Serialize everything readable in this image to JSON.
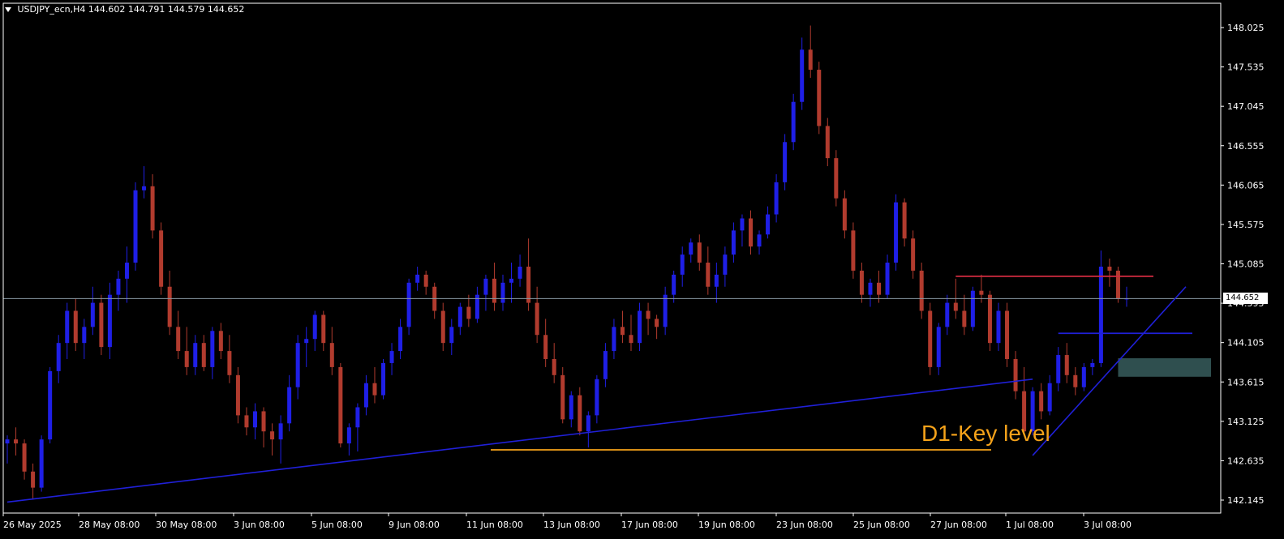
{
  "header": {
    "symbol": "USDJPY_ecn,H4",
    "ohlc": "144.602 144.791 144.579 144.652"
  },
  "annotation": {
    "key_level_label": "D1-Key level"
  },
  "current_price_label": "144.652",
  "colors": {
    "background": "#000000",
    "bull": "#1f1fe6",
    "bear": "#b13b2e",
    "axis": "#ffffff",
    "trendline": "#2020d8",
    "resistance": "#d22b40",
    "key_level": "#f5a21a",
    "support_zone": "#2f4f4f",
    "current_price_line": "#8a9aa4"
  },
  "chart_data": {
    "type": "candlestick",
    "title": "",
    "xlabel": "",
    "ylabel": "",
    "ylim": [
      142.0,
      148.3
    ],
    "y_ticks": [
      "148.025",
      "147.535",
      "147.045",
      "146.555",
      "146.065",
      "145.575",
      "145.085",
      "144.595",
      "144.105",
      "143.615",
      "143.125",
      "142.635",
      "142.145"
    ],
    "x_ticks": [
      "26 May 2025",
      "28 May 08:00",
      "30 May 08:00",
      "3 Jun 08:00",
      "5 Jun 08:00",
      "9 Jun 08:00",
      "11 Jun 08:00",
      "13 Jun 08:00",
      "17 Jun 08:00",
      "19 Jun 08:00",
      "23 Jun 08:00",
      "25 Jun 08:00",
      "27 Jun 08:00",
      "1 Jul 08:00",
      "3 Jul 08:00"
    ],
    "current_price": 144.652,
    "candles": [
      [
        142.85,
        142.95,
        142.6,
        142.9
      ],
      [
        142.9,
        143.05,
        142.7,
        142.85
      ],
      [
        142.85,
        142.9,
        142.4,
        142.5
      ],
      [
        142.5,
        142.6,
        142.15,
        142.3
      ],
      [
        142.3,
        142.95,
        142.25,
        142.9
      ],
      [
        142.9,
        143.8,
        142.85,
        143.75
      ],
      [
        143.75,
        144.2,
        143.6,
        144.1
      ],
      [
        144.1,
        144.6,
        143.9,
        144.5
      ],
      [
        144.5,
        144.65,
        144.0,
        144.1
      ],
      [
        144.1,
        144.4,
        143.9,
        144.3
      ],
      [
        144.3,
        144.8,
        144.2,
        144.6
      ],
      [
        144.6,
        144.7,
        143.95,
        144.05
      ],
      [
        144.05,
        144.85,
        143.9,
        144.7
      ],
      [
        144.7,
        145.0,
        144.5,
        144.9
      ],
      [
        144.9,
        145.3,
        144.6,
        145.1
      ],
      [
        145.1,
        146.1,
        145.0,
        146.0
      ],
      [
        146.0,
        146.3,
        145.9,
        146.05
      ],
      [
        146.05,
        146.2,
        145.4,
        145.5
      ],
      [
        145.5,
        145.6,
        144.7,
        144.8
      ],
      [
        144.8,
        145.0,
        144.2,
        144.3
      ],
      [
        144.3,
        144.5,
        143.9,
        144.0
      ],
      [
        144.0,
        144.3,
        143.7,
        143.8
      ],
      [
        143.8,
        144.2,
        143.7,
        144.1
      ],
      [
        144.1,
        144.2,
        143.75,
        143.8
      ],
      [
        143.8,
        144.3,
        143.65,
        144.25
      ],
      [
        144.25,
        144.35,
        143.9,
        144.0
      ],
      [
        144.0,
        144.2,
        143.6,
        143.7
      ],
      [
        143.7,
        143.8,
        143.1,
        143.2
      ],
      [
        143.2,
        143.3,
        142.95,
        143.05
      ],
      [
        143.05,
        143.35,
        142.9,
        143.25
      ],
      [
        143.25,
        143.3,
        142.8,
        143.0
      ],
      [
        143.0,
        143.1,
        142.7,
        142.9
      ],
      [
        142.9,
        143.2,
        142.6,
        143.1
      ],
      [
        143.1,
        143.7,
        143.0,
        143.55
      ],
      [
        143.55,
        144.2,
        143.4,
        144.1
      ],
      [
        144.1,
        144.3,
        143.8,
        144.15
      ],
      [
        144.15,
        144.5,
        144.0,
        144.45
      ],
      [
        144.45,
        144.5,
        144.0,
        144.1
      ],
      [
        144.1,
        144.3,
        143.7,
        143.8
      ],
      [
        143.8,
        143.85,
        142.8,
        142.85
      ],
      [
        142.85,
        143.1,
        142.7,
        143.05
      ],
      [
        143.05,
        143.35,
        142.75,
        143.3
      ],
      [
        143.3,
        143.7,
        143.2,
        143.6
      ],
      [
        143.6,
        143.8,
        143.35,
        143.45
      ],
      [
        143.45,
        143.9,
        143.4,
        143.85
      ],
      [
        143.85,
        144.1,
        143.7,
        144.0
      ],
      [
        144.0,
        144.4,
        143.9,
        144.3
      ],
      [
        144.3,
        144.9,
        144.2,
        144.85
      ],
      [
        144.85,
        145.05,
        144.75,
        144.95
      ],
      [
        144.95,
        145.0,
        144.7,
        144.8
      ],
      [
        144.8,
        144.85,
        144.4,
        144.5
      ],
      [
        144.5,
        144.6,
        144.0,
        144.1
      ],
      [
        144.1,
        144.4,
        143.95,
        144.3
      ],
      [
        144.3,
        144.6,
        144.2,
        144.55
      ],
      [
        144.55,
        144.7,
        144.3,
        144.4
      ],
      [
        144.4,
        144.8,
        144.35,
        144.7
      ],
      [
        144.7,
        144.95,
        144.5,
        144.9
      ],
      [
        144.9,
        145.1,
        144.5,
        144.6
      ],
      [
        144.6,
        144.95,
        144.5,
        144.85
      ],
      [
        144.85,
        145.1,
        144.6,
        144.9
      ],
      [
        144.9,
        145.2,
        144.8,
        145.05
      ],
      [
        145.05,
        145.4,
        144.5,
        144.6
      ],
      [
        144.6,
        144.8,
        144.1,
        144.2
      ],
      [
        144.2,
        144.4,
        143.8,
        143.9
      ],
      [
        143.9,
        144.1,
        143.6,
        143.7
      ],
      [
        143.7,
        143.8,
        143.1,
        143.15
      ],
      [
        143.15,
        143.5,
        143.05,
        143.45
      ],
      [
        143.45,
        143.55,
        142.95,
        143.0
      ],
      [
        143.0,
        143.25,
        142.8,
        143.2
      ],
      [
        143.2,
        143.7,
        143.1,
        143.65
      ],
      [
        143.65,
        144.1,
        143.55,
        144.0
      ],
      [
        144.0,
        144.4,
        143.9,
        144.3
      ],
      [
        144.3,
        144.5,
        144.1,
        144.2
      ],
      [
        144.2,
        144.45,
        144.0,
        144.1
      ],
      [
        144.1,
        144.6,
        144.0,
        144.5
      ],
      [
        144.5,
        144.6,
        144.2,
        144.4
      ],
      [
        144.4,
        144.45,
        144.15,
        144.3
      ],
      [
        144.3,
        144.8,
        144.2,
        144.7
      ],
      [
        144.7,
        145.0,
        144.6,
        144.95
      ],
      [
        144.95,
        145.3,
        144.8,
        145.2
      ],
      [
        145.2,
        145.4,
        145.1,
        145.35
      ],
      [
        145.35,
        145.45,
        145.0,
        145.1
      ],
      [
        145.1,
        145.3,
        144.7,
        144.8
      ],
      [
        144.8,
        145.1,
        144.6,
        144.95
      ],
      [
        144.95,
        145.3,
        144.8,
        145.2
      ],
      [
        145.2,
        145.6,
        145.1,
        145.5
      ],
      [
        145.5,
        145.7,
        145.3,
        145.65
      ],
      [
        145.65,
        145.75,
        145.2,
        145.3
      ],
      [
        145.3,
        145.5,
        145.2,
        145.45
      ],
      [
        145.45,
        145.8,
        145.4,
        145.7
      ],
      [
        145.7,
        146.2,
        145.6,
        146.1
      ],
      [
        146.1,
        146.7,
        146.0,
        146.6
      ],
      [
        146.6,
        147.2,
        146.5,
        147.1
      ],
      [
        147.1,
        147.9,
        147.0,
        147.75
      ],
      [
        147.75,
        148.05,
        147.4,
        147.5
      ],
      [
        147.5,
        147.6,
        146.7,
        146.8
      ],
      [
        146.8,
        146.9,
        146.3,
        146.4
      ],
      [
        146.4,
        146.5,
        145.8,
        145.9
      ],
      [
        145.9,
        146.0,
        145.4,
        145.5
      ],
      [
        145.5,
        145.6,
        144.9,
        145.0
      ],
      [
        145.0,
        145.1,
        144.6,
        144.7
      ],
      [
        144.7,
        144.9,
        144.55,
        144.85
      ],
      [
        144.85,
        145.0,
        144.6,
        144.7
      ],
      [
        144.7,
        145.2,
        144.65,
        145.1
      ],
      [
        145.1,
        145.95,
        145.0,
        145.85
      ],
      [
        145.85,
        145.9,
        145.3,
        145.4
      ],
      [
        145.4,
        145.5,
        144.9,
        145.0
      ],
      [
        145.0,
        145.1,
        144.4,
        144.5
      ],
      [
        144.5,
        144.6,
        143.7,
        143.8
      ],
      [
        143.8,
        144.35,
        143.7,
        144.3
      ],
      [
        144.3,
        144.7,
        144.2,
        144.6
      ],
      [
        144.6,
        144.9,
        144.4,
        144.5
      ],
      [
        144.5,
        144.7,
        144.2,
        144.3
      ],
      [
        144.3,
        144.8,
        144.25,
        144.75
      ],
      [
        144.75,
        144.95,
        144.6,
        144.7
      ],
      [
        144.7,
        144.75,
        144.0,
        144.1
      ],
      [
        144.1,
        144.6,
        144.0,
        144.5
      ],
      [
        144.5,
        144.6,
        143.8,
        143.9
      ],
      [
        143.9,
        144.0,
        143.4,
        143.5
      ],
      [
        143.5,
        143.8,
        142.95,
        143.0
      ],
      [
        143.0,
        143.55,
        142.95,
        143.5
      ],
      [
        143.5,
        143.6,
        143.15,
        143.25
      ],
      [
        143.25,
        143.7,
        143.2,
        143.6
      ],
      [
        143.6,
        144.05,
        143.5,
        143.95
      ],
      [
        143.95,
        144.1,
        143.6,
        143.7
      ],
      [
        143.7,
        143.8,
        143.45,
        143.55
      ],
      [
        143.55,
        143.85,
        143.5,
        143.8
      ],
      [
        143.8,
        143.9,
        143.7,
        143.85
      ],
      [
        143.85,
        145.25,
        143.8,
        145.05
      ],
      [
        145.05,
        145.15,
        144.8,
        145.0
      ],
      [
        145.0,
        145.05,
        144.6,
        144.65
      ],
      [
        144.65,
        144.8,
        144.55,
        144.652
      ]
    ],
    "lines": [
      {
        "name": "",
        "kind": "trendline",
        "color": "blue",
        "points": [
          [
            0,
            142.12
          ],
          [
            120,
            143.65
          ]
        ]
      },
      {
        "name": "",
        "kind": "trendline",
        "color": "blue",
        "points": [
          [
            120,
            142.7
          ],
          [
            132,
            144.8
          ]
        ]
      },
      {
        "name": "",
        "kind": "horizontal",
        "color": "red",
        "y": 144.93,
        "x_range": [
          111,
          131
        ]
      },
      {
        "name": "",
        "kind": "horizontal",
        "color": "blue",
        "y": 144.22,
        "x_range": [
          123,
          132
        ]
      },
      {
        "name": "",
        "kind": "horizontal",
        "color": "orange",
        "y": 142.77,
        "x_range": [
          60,
          120
        ]
      }
    ],
    "zones": [
      {
        "kind": "support",
        "y_range": [
          143.68,
          143.91
        ],
        "x_range": [
          130,
          133
        ]
      }
    ],
    "grid": false,
    "legend": "none"
  }
}
